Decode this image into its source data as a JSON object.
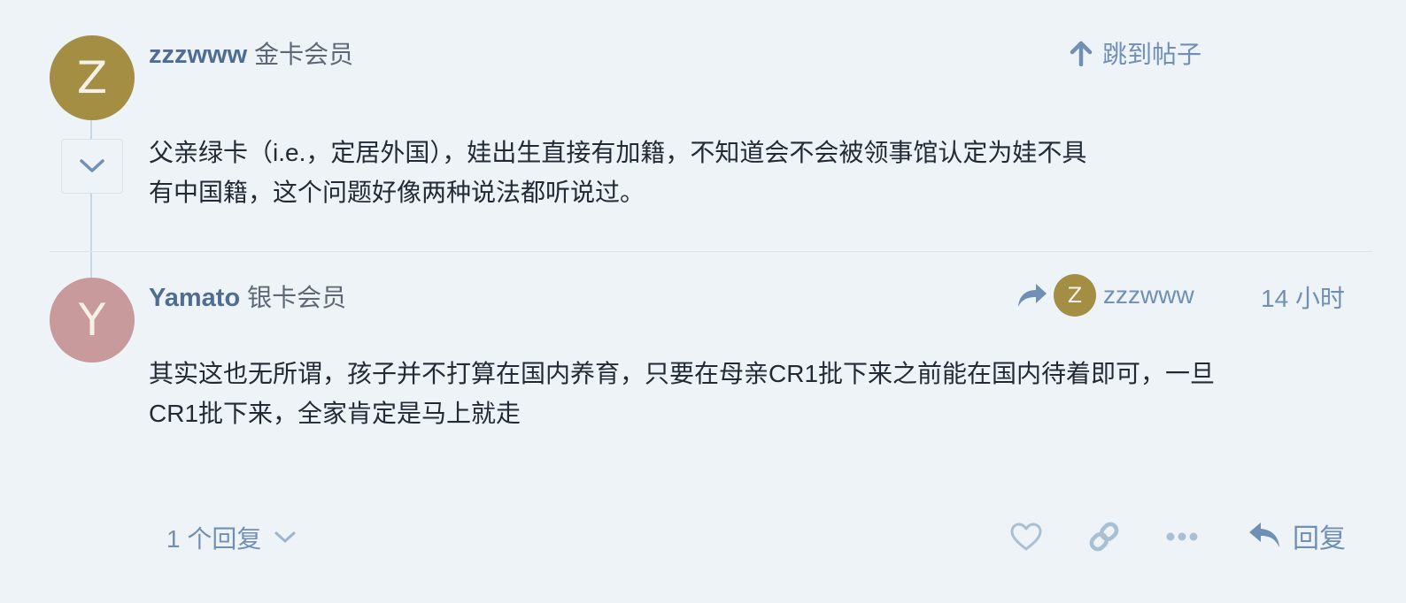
{
  "colors": {
    "background": "#eef3f7",
    "username": "#4f6d92",
    "link_blue": "#6f8fb4",
    "avatar_z": "#a38e44",
    "avatar_y": "#c99a9b"
  },
  "jump_to_post": {
    "icon": "arrow-up-icon",
    "label": "跳到帖子"
  },
  "post1": {
    "avatar_letter": "Z",
    "username": "zzzwww",
    "user_title": "金卡会员",
    "collapse_icon": "chevron-down-icon",
    "text_line1": "父亲绿卡（i.e.，定居外国），娃出生直接有加籍，不知道会不会被领事馆认定为娃不具",
    "text_line2": "有中国籍，这个问题好像两种说法都听说过。"
  },
  "post2": {
    "avatar_letter": "Y",
    "username": "Yamato",
    "user_title": "银卡会员",
    "reply_to": {
      "icon": "reply-arrow-icon",
      "avatar_letter": "Z",
      "username": "zzzwww"
    },
    "time": "14 小时",
    "text_line1": "其实这也无所谓，孩子并不打算在国内养育，只要在母亲CR1批下来之前能在国内待着即可，一旦",
    "text_line2": "CR1批下来，全家肯定是马上就走",
    "replies_label": "1 个回复",
    "actions": {
      "like_icon": "heart-icon",
      "link_icon": "link-icon",
      "more_icon": "ellipsis-icon",
      "reply_icon": "reply-icon",
      "reply_label": "回复"
    }
  }
}
